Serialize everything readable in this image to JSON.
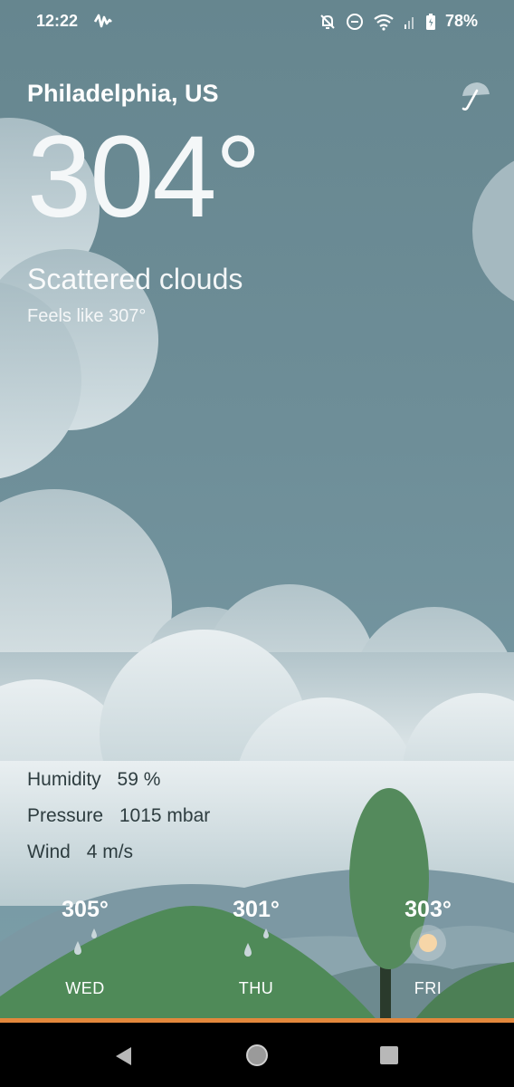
{
  "status_bar": {
    "time": "12:22",
    "battery": "78%",
    "icons": [
      "waveform-app-icon",
      "bell-off-icon",
      "do-not-disturb-icon",
      "wifi-icon",
      "cell-signal-icon",
      "battery-icon"
    ]
  },
  "location": {
    "city": "Philadelphia, US"
  },
  "current": {
    "temperature": "304°",
    "description": "Scattered clouds",
    "feels_like_label": "Feels like",
    "feels_like_value": "307°"
  },
  "details": {
    "humidity_label": "Humidity",
    "humidity_value": "59 %",
    "pressure_label": "Pressure",
    "pressure_value": "1015 mbar",
    "wind_label": "Wind",
    "wind_value": "4 m/s"
  },
  "forecast": [
    {
      "day": "WED",
      "temp": "305°",
      "icon": "rain-drops-icon"
    },
    {
      "day": "THU",
      "temp": "301°",
      "icon": "rain-drops-icon"
    },
    {
      "day": "FRI",
      "temp": "303°",
      "icon": "sun-icon"
    }
  ],
  "colors": {
    "sky": "#6e8e98",
    "cloud": "#e8eef0",
    "hill": "#4f8a58",
    "tree": "#548a5c",
    "accent": "#e3883c"
  }
}
